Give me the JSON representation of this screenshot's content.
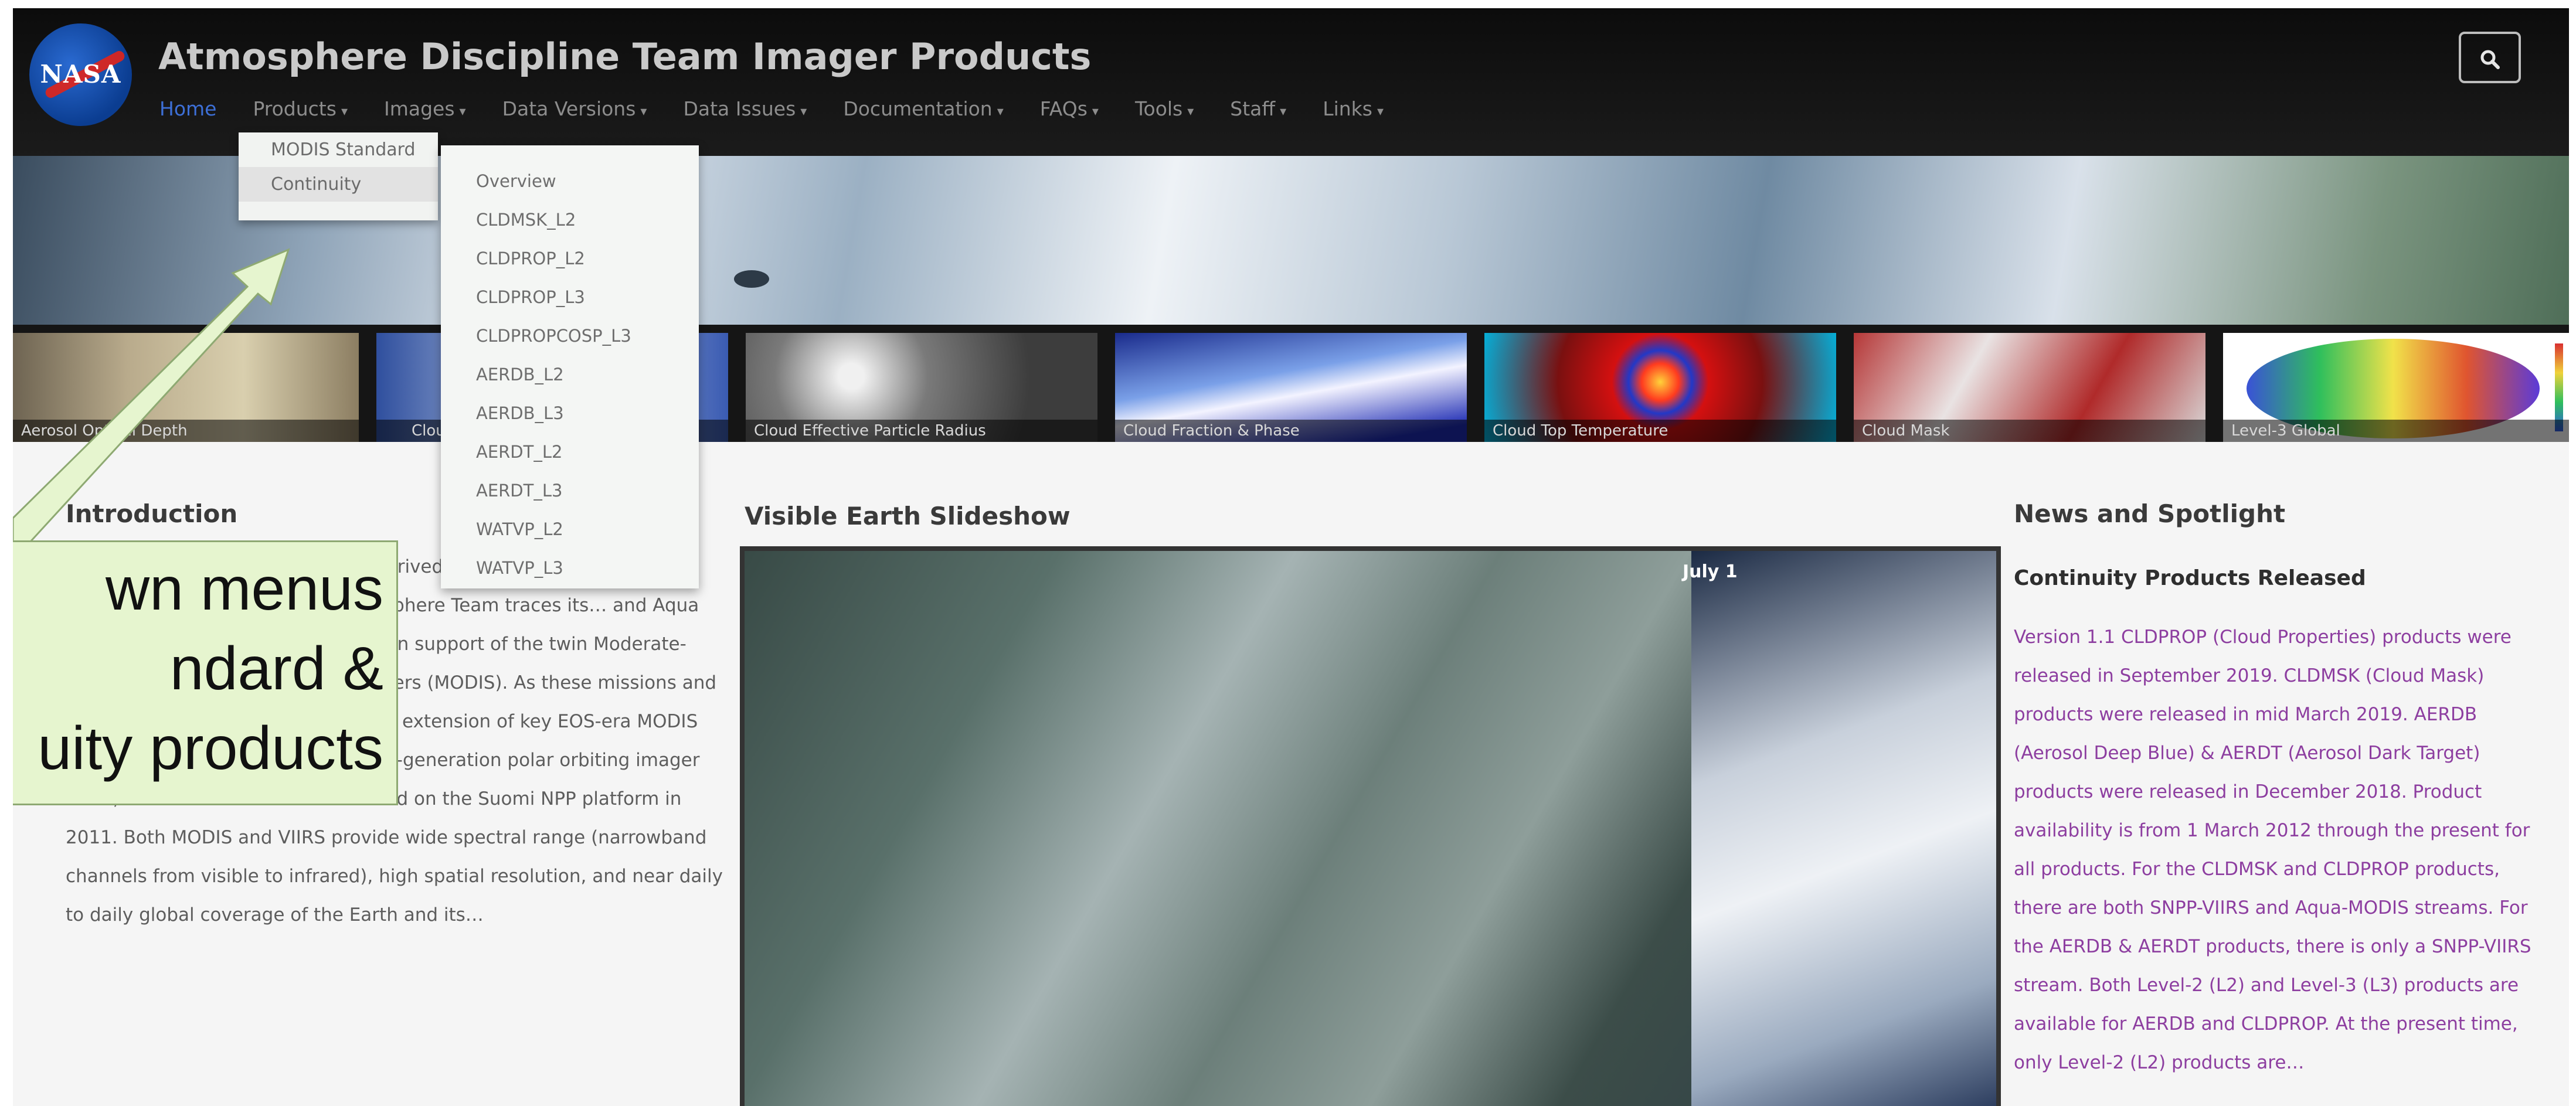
{
  "header": {
    "logo_text": "NASA",
    "site_title": "Atmosphere Discipline Team Imager Products",
    "nav": [
      {
        "label": "Home",
        "active": true
      },
      {
        "label": "Products",
        "caret": "▾"
      },
      {
        "label": "Images",
        "caret": "▾"
      },
      {
        "label": "Data Versions",
        "caret": "▾"
      },
      {
        "label": "Data Issues",
        "caret": "▾"
      },
      {
        "label": "Documentation",
        "caret": "▾"
      },
      {
        "label": "FAQs",
        "caret": "▾"
      },
      {
        "label": "Tools",
        "caret": "▾"
      },
      {
        "label": "Staff",
        "caret": "▾"
      },
      {
        "label": "Links",
        "caret": "▾"
      }
    ],
    "search_icon": "search-icon",
    "search_glyph": "🔍"
  },
  "products_menu": [
    "MODIS Standard",
    "Continuity"
  ],
  "continuity_menu": [
    "Overview",
    "CLDMSK_L2",
    "CLDPROP_L2",
    "CLDPROP_L3",
    "CLDPROPCOSP_L3",
    "AERDB_L2",
    "AERDB_L3",
    "AERDT_L2",
    "AERDT_L3",
    "WATVP_L2",
    "WATVP_L3"
  ],
  "thumbnails": [
    "Aerosol Optical Depth",
    "Cloud",
    "Cloud Effective Particle Radius",
    "Cloud Fraction & Phase",
    "Cloud Top Temperature",
    "Cloud Mask",
    "Level-3 Global"
  ],
  "intro": {
    "title": "Introduction",
    "text": "…algorithms for the creation of… derived geophysical… atmospheric properties of the Earth… The Atmosphere Team traces its… and Aqua missions, launched in… specifically in support of the twin Moderate-resolution Imaging Spectroradiometers (MODIS). As these missions and sensors age, NASA is supporting the extension of key EOS-era MODIS climate data records to NOAA's next-generation polar orbiting imager VIIRS, the first of which was launched on the Suomi NPP platform in 2011. Both MODIS and VIIRS provide wide spectral range (narrowband channels from visible to infrared), high spatial resolution, and near daily to daily global coverage of the Earth and its…"
  },
  "slideshow": {
    "title": "Visible Earth Slideshow",
    "date": "July 1"
  },
  "news": {
    "title": "News and Spotlight",
    "subtitle": "Continuity Products Released",
    "text": "Version 1.1 CLDPROP (Cloud Properties) products were released in September 2019. CLDMSK (Cloud Mask) products were released in mid March 2019. AERDB (Aerosol Deep Blue) & AERDT (Aerosol Dark Target) products were released in December 2018. Product availability is from 1 March 2012 through the present for all products. For the CLDMSK and CLDPROP products, there are both SNPP-VIIRS and Aqua-MODIS streams. For the AERDB & AERDT products, there is only a SNPP-VIIRS stream. Both Level-2 (L2) and Level-3 (L3) products are available for AERDB and CLDPROP. At the present time, only Level-2 (L2) products are…"
  },
  "callout": {
    "lines": [
      "wn menus",
      "ndard &",
      "uity products"
    ]
  },
  "colors": {
    "nav_active": "#3d6fd6",
    "news_text": "#8d3ea0",
    "callout_bg": "#e6f5cf"
  }
}
